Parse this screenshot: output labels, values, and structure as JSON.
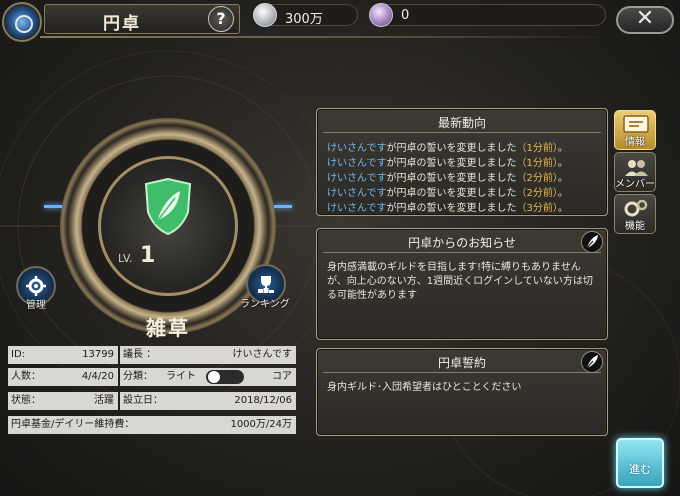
{
  "header": {
    "title": "円卓",
    "help_label": "?",
    "close_label": "✕",
    "currency": [
      {
        "icon": "silver-coin-icon",
        "value": "300万"
      },
      {
        "icon": "gem-icon",
        "value": "0"
      }
    ]
  },
  "emblem": {
    "level_prefix": "LV.",
    "level": "1",
    "icon": "leaf-shield-icon",
    "accent_color": "#3fbd6a"
  },
  "buttons": {
    "manage_label": "管理",
    "ranking_label": "ランキング"
  },
  "guild": {
    "name": "雑草",
    "id_label": "ID:",
    "id_value": "13799",
    "leader_label": "議長 ：",
    "leader_value": "けいさんです",
    "members_label": "人数：",
    "members_value": "4/4/20",
    "category_label": "分類：",
    "category_left": "ライト",
    "category_right": "コア",
    "status_label": "状態：",
    "status_value": "活躍",
    "founded_label": "設立日：",
    "founded_value": "2018/12/06",
    "fund_label": "円卓基金/デイリー維持費：",
    "fund_value": "1000万/24万"
  },
  "news": {
    "title": "最新動向",
    "items": [
      {
        "user": "けいさんです",
        "text": "が円卓の誓いを変更しました",
        "time": "（1分前）",
        "end": "。"
      },
      {
        "user": "けいさんです",
        "text": "が円卓の誓いを変更しました",
        "time": "（1分前）",
        "end": "。"
      },
      {
        "user": "けいさんです",
        "text": "が円卓の誓いを変更しました",
        "time": "（2分前）",
        "end": "。"
      },
      {
        "user": "けいさんです",
        "text": "が円卓の誓いを変更しました",
        "time": "（2分前）",
        "end": "。"
      },
      {
        "user": "けいさんです",
        "text": "が円卓の誓いを変更しました",
        "time": "（3分前）",
        "end": "。"
      }
    ]
  },
  "notice": {
    "title": "円卓からのお知らせ",
    "body": "身内感満載のギルドを目指します!特に縛りもありませんが、向上心のない方、1週間近くログインしていない方は切る可能性があります"
  },
  "pledge": {
    "title": "円卓誓約",
    "body": "身内ギルド･入団希望者はひとことください"
  },
  "side_tabs": [
    {
      "label": "情報",
      "icon": "info-board-icon",
      "active": true
    },
    {
      "label": "メンバー",
      "icon": "members-icon",
      "active": false
    },
    {
      "label": "機能",
      "icon": "gears-icon",
      "active": false
    }
  ],
  "go_button_label": "進む"
}
